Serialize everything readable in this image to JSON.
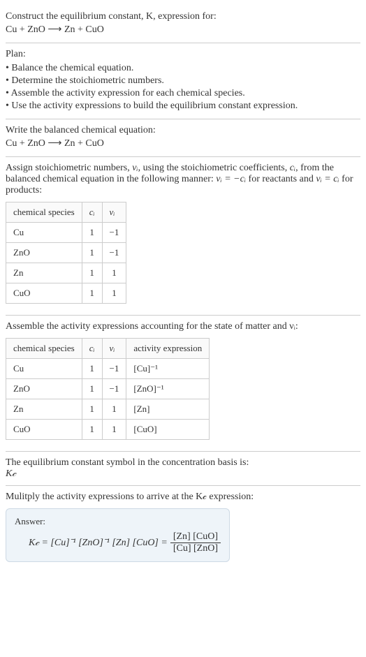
{
  "intro": {
    "line1": "Construct the equilibrium constant, K, expression for:",
    "equation": "Cu + ZnO ⟶ Zn + CuO"
  },
  "plan": {
    "heading": "Plan:",
    "items": [
      "• Balance the chemical equation.",
      "• Determine the stoichiometric numbers.",
      "• Assemble the activity expression for each chemical species.",
      "• Use the activity expressions to build the equilibrium constant expression."
    ]
  },
  "balanced": {
    "heading": "Write the balanced chemical equation:",
    "equation": "Cu + ZnO ⟶ Zn + CuO"
  },
  "stoich": {
    "text_pre": "Assign stoichiometric numbers, ",
    "nu_i": "νᵢ",
    "text_mid1": ", using the stoichiometric coefficients, ",
    "c_i": "cᵢ",
    "text_mid2": ", from the balanced chemical equation in the following manner: ",
    "rule_reactants": "νᵢ = −cᵢ",
    "text_mid3": " for reactants and ",
    "rule_products": "νᵢ = cᵢ",
    "text_end": " for products:",
    "table": {
      "headers": [
        "chemical species",
        "cᵢ",
        "νᵢ"
      ],
      "rows": [
        [
          "Cu",
          "1",
          "−1"
        ],
        [
          "ZnO",
          "1",
          "−1"
        ],
        [
          "Zn",
          "1",
          "1"
        ],
        [
          "CuO",
          "1",
          "1"
        ]
      ]
    }
  },
  "activity": {
    "heading": "Assemble the activity expressions accounting for the state of matter and νᵢ:",
    "table": {
      "headers": [
        "chemical species",
        "cᵢ",
        "νᵢ",
        "activity expression"
      ],
      "rows": [
        [
          "Cu",
          "1",
          "−1",
          "[Cu]⁻¹"
        ],
        [
          "ZnO",
          "1",
          "−1",
          "[ZnO]⁻¹"
        ],
        [
          "Zn",
          "1",
          "1",
          "[Zn]"
        ],
        [
          "CuO",
          "1",
          "1",
          "[CuO]"
        ]
      ]
    }
  },
  "symbol": {
    "heading": "The equilibrium constant symbol in the concentration basis is:",
    "value": "K𝒸"
  },
  "multiply": {
    "heading": "Mulitply the activity expressions to arrive at the K𝒸 expression:"
  },
  "answer": {
    "label": "Answer:",
    "lhs": "K𝒸 = [Cu]⁻¹ [ZnO]⁻¹ [Zn] [CuO] = ",
    "frac_num": "[Zn] [CuO]",
    "frac_den": "[Cu] [ZnO]"
  },
  "chart_data": {
    "type": "table",
    "tables": [
      {
        "title": "Stoichiometric numbers",
        "headers": [
          "chemical species",
          "c_i",
          "nu_i"
        ],
        "rows": [
          {
            "chemical species": "Cu",
            "c_i": 1,
            "nu_i": -1
          },
          {
            "chemical species": "ZnO",
            "c_i": 1,
            "nu_i": -1
          },
          {
            "chemical species": "Zn",
            "c_i": 1,
            "nu_i": 1
          },
          {
            "chemical species": "CuO",
            "c_i": 1,
            "nu_i": 1
          }
        ]
      },
      {
        "title": "Activity expressions",
        "headers": [
          "chemical species",
          "c_i",
          "nu_i",
          "activity expression"
        ],
        "rows": [
          {
            "chemical species": "Cu",
            "c_i": 1,
            "nu_i": -1,
            "activity expression": "[Cu]^-1"
          },
          {
            "chemical species": "ZnO",
            "c_i": 1,
            "nu_i": -1,
            "activity expression": "[ZnO]^-1"
          },
          {
            "chemical species": "Zn",
            "c_i": 1,
            "nu_i": 1,
            "activity expression": "[Zn]"
          },
          {
            "chemical species": "CuO",
            "c_i": 1,
            "nu_i": 1,
            "activity expression": "[CuO]"
          }
        ]
      }
    ]
  }
}
